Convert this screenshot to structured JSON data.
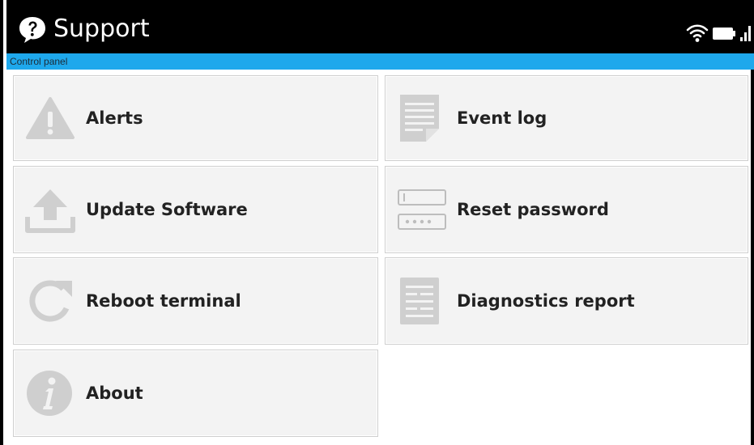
{
  "header": {
    "title": "Support",
    "breadcrumb": "Control panel",
    "colors": {
      "titlebar": "#000000",
      "breadcrumb_bar": "#1ea8ec"
    },
    "status_icons": [
      "wifi-icon",
      "battery-icon",
      "signal-strength-icon"
    ]
  },
  "tiles": [
    {
      "label": "Alerts",
      "icon": "warning-triangle-icon"
    },
    {
      "label": "Event log",
      "icon": "document-icon"
    },
    {
      "label": "Update Software",
      "icon": "upload-icon"
    },
    {
      "label": "Reset password",
      "icon": "password-field-icon"
    },
    {
      "label": "Reboot terminal",
      "icon": "refresh-icon"
    },
    {
      "label": "Diagnostics report",
      "icon": "report-icon"
    },
    {
      "label": "About",
      "icon": "info-icon"
    }
  ]
}
